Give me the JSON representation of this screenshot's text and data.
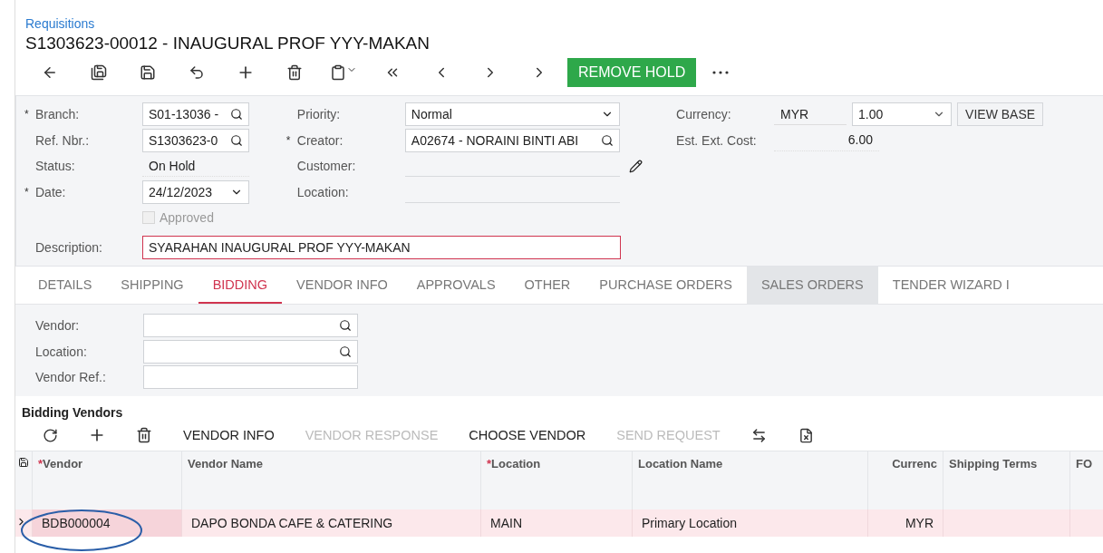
{
  "breadcrumb": "Requisitions",
  "title": "S1303623-00012 - INAUGURAL PROF YYY-MAKAN",
  "toolbar": {
    "icons": [
      {
        "kind": "back"
      },
      {
        "kind": "save-close"
      },
      {
        "kind": "save"
      },
      {
        "kind": "undo"
      },
      {
        "kind": "add"
      },
      {
        "kind": "delete"
      },
      {
        "kind": "clipboard"
      },
      {
        "kind": "first"
      },
      {
        "kind": "prev"
      },
      {
        "kind": "next"
      },
      {
        "kind": "last"
      }
    ],
    "primary_button": "REMOVE HOLD"
  },
  "form": {
    "column_1": [
      {
        "mark": "*",
        "label": "Branch:",
        "kind": "search",
        "value": "S01-13036 -"
      },
      {
        "label": "Ref. Nbr.:",
        "kind": "search",
        "value": "S1303623-0"
      },
      {
        "label": "Status:",
        "kind": "text",
        "value": "On Hold"
      },
      {
        "mark": "*",
        "label": "Date:",
        "kind": "select",
        "value": "24/12/2023"
      },
      {
        "kind": "checkbox",
        "label": "Approved",
        "checked": false,
        "disabled": true
      }
    ],
    "column_2": [
      {
        "label": "Priority:",
        "kind": "select",
        "value": "Normal"
      },
      {
        "mark": "*",
        "label": "Creator:",
        "kind": "search",
        "value": "A02674 - NORAINI BINTI ABI"
      },
      {
        "label": "Customer:",
        "kind": "line",
        "edit": true
      },
      {
        "label": "Location:",
        "kind": "line"
      }
    ],
    "column_3": [
      {
        "label": "Currency:",
        "kind": "currency",
        "value": "MYR",
        "rate": "1.00",
        "button": "VIEW BASE"
      },
      {
        "label": "Est. Ext. Cost:",
        "kind": "amount",
        "value": "6.00"
      }
    ],
    "description": {
      "label": "Description:",
      "value": "SYARAHAN INAUGURAL PROF YYY-MAKAN",
      "invalid": true
    }
  },
  "tabs": [
    {
      "label": "DETAILS",
      "selected": false,
      "hovered": false
    },
    {
      "label": "SHIPPING",
      "selected": false,
      "hovered": false
    },
    {
      "label": "BIDDING",
      "selected": true,
      "hovered": false
    },
    {
      "label": "VENDOR INFO",
      "selected": false,
      "hovered": false
    },
    {
      "label": "APPROVALS",
      "selected": false,
      "hovered": false
    },
    {
      "label": "OTHER",
      "selected": false,
      "hovered": false
    },
    {
      "label": "PURCHASE ORDERS",
      "selected": false,
      "hovered": false
    },
    {
      "label": "SALES ORDERS",
      "selected": false,
      "hovered": true
    },
    {
      "label": "TENDER WIZARD I",
      "selected": false,
      "hovered": false
    }
  ],
  "filters": [
    {
      "label": "Vendor:",
      "kind": "search"
    },
    {
      "label": "Location:",
      "kind": "search"
    },
    {
      "label": "Vendor Ref.:",
      "kind": "text"
    }
  ],
  "grid": {
    "title": "Bidding Vendors",
    "toolbar": [
      {
        "kind": "refresh"
      },
      {
        "kind": "add"
      },
      {
        "kind": "delete"
      },
      {
        "kind": "button",
        "label": "VENDOR INFO",
        "disabled": false
      },
      {
        "kind": "button",
        "label": "VENDOR RESPONSE",
        "disabled": true
      },
      {
        "kind": "button",
        "label": "CHOOSE VENDOR",
        "disabled": false
      },
      {
        "kind": "button",
        "label": "SEND REQUEST",
        "disabled": true
      },
      {
        "kind": "fit"
      },
      {
        "kind": "excel"
      }
    ],
    "columns": [
      {
        "mark": "*",
        "label": "Vendor",
        "kind": "text"
      },
      {
        "label": "Vendor Name",
        "kind": "text"
      },
      {
        "mark": "*",
        "label": "Location",
        "kind": "text"
      },
      {
        "label": "Location Name",
        "kind": "text"
      },
      {
        "label": "Currenc",
        "kind": "code"
      },
      {
        "label": "Shipping Terms",
        "kind": "text"
      },
      {
        "label": "FO",
        "kind": "text"
      }
    ],
    "rows": [
      {
        "selected": true,
        "cells": [
          {
            "text": "BDB000004",
            "active": true
          },
          {
            "text": "DAPO BONDA CAFE & CATERING",
            "active": false
          },
          {
            "text": "MAIN",
            "active": false
          },
          {
            "text": "Primary Location",
            "active": false
          },
          {
            "text": "MYR",
            "active": false
          }
        ]
      }
    ]
  }
}
